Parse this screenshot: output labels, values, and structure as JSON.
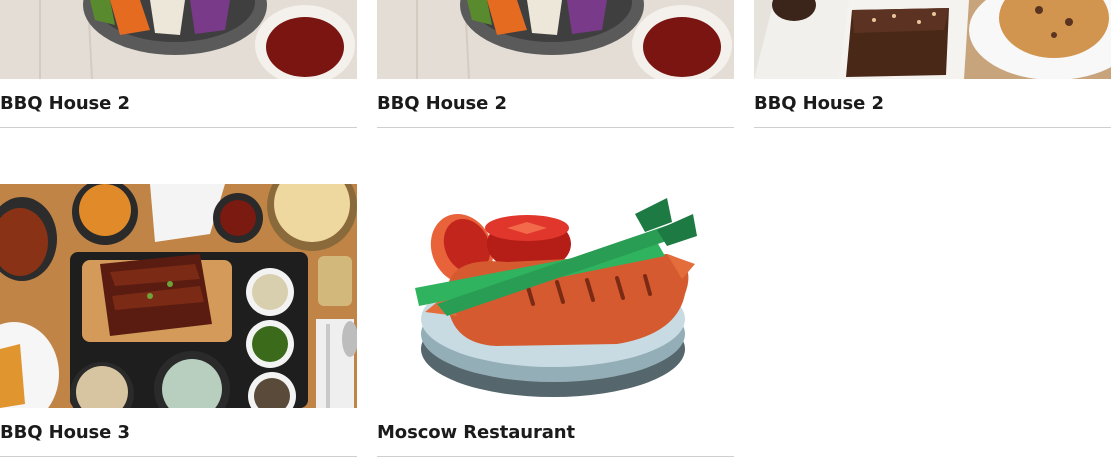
{
  "restaurants": [
    {
      "name": "BBQ House 2",
      "image": "bibimbap-dish-photo"
    },
    {
      "name": "BBQ House 2",
      "image": "bibimbap-dish-photo"
    },
    {
      "name": "BBQ House 2",
      "image": "desserts-photo"
    },
    {
      "name": "BBQ House 3",
      "image": "korean-bbq-spread-photo"
    },
    {
      "name": "Moscow Restaurant",
      "image": "sausage-plate-illustration"
    }
  ]
}
